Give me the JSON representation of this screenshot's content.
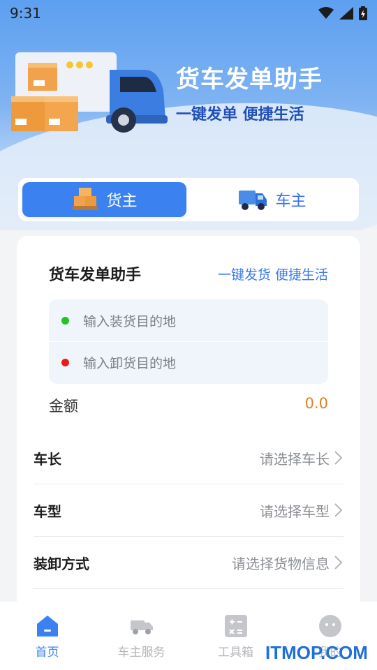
{
  "status_bar": {
    "time": "9:31",
    "icons": [
      "wifi-icon",
      "signal-icon",
      "battery-icon"
    ]
  },
  "hero": {
    "title": "货车发单助手",
    "subtitle": "一键发单 便捷生活"
  },
  "role_tabs": [
    {
      "label": "货主",
      "icon": "cargo-boxes-icon",
      "active": true
    },
    {
      "label": "车主",
      "icon": "truck-icon",
      "active": false
    }
  ],
  "card": {
    "title": "货车发单助手",
    "slogan": "一键发货 便捷生活",
    "load_input": {
      "placeholder": "输入装货目的地",
      "dot_color": "#22c422"
    },
    "unload_input": {
      "placeholder": "输入卸货目的地",
      "dot_color": "#e81b1b"
    },
    "amount": {
      "label": "金额",
      "value": "0.0"
    },
    "options": [
      {
        "label": "车长",
        "placeholder": "请选择车长"
      },
      {
        "label": "车型",
        "placeholder": "请选择车型"
      },
      {
        "label": "装卸方式",
        "placeholder": "请选择货物信息"
      }
    ]
  },
  "bottom_nav": [
    {
      "label": "首页",
      "icon": "home-icon",
      "active": true
    },
    {
      "label": "车主服务",
      "icon": "truck-icon",
      "active": false
    },
    {
      "label": "工具箱",
      "icon": "calculator-icon",
      "active": false
    },
    {
      "label": "我的",
      "icon": "profile-icon",
      "active": false
    }
  ],
  "watermark": "ITMOP.COM",
  "colors": {
    "accent": "#3b82f0",
    "amount": "#d9822b",
    "hero_top": "#5d9ff0"
  }
}
